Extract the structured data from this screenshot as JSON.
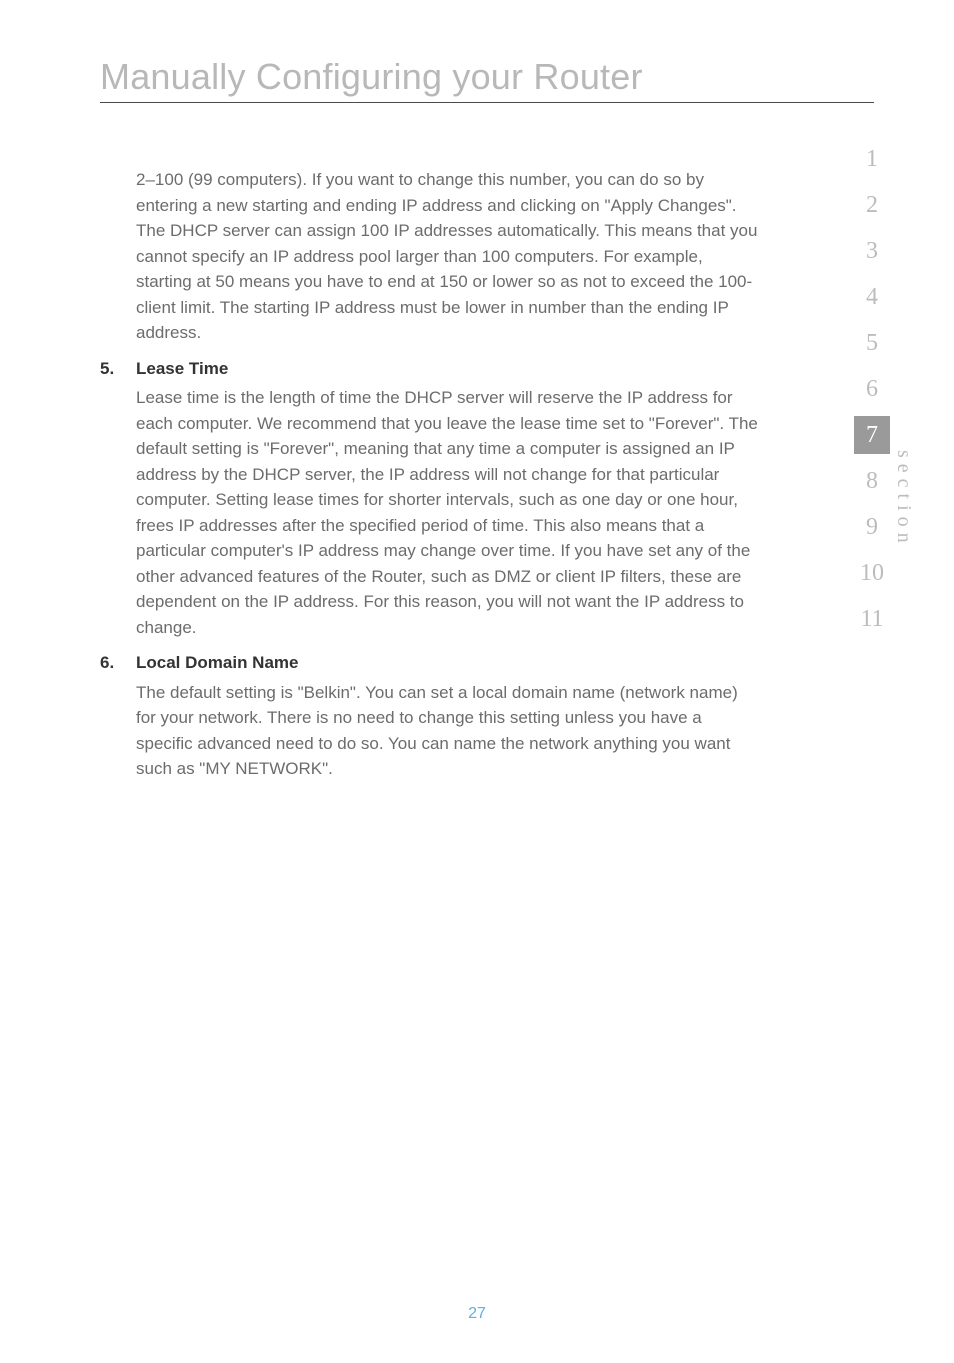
{
  "chapter": {
    "title": "Manually Configuring your Router"
  },
  "content": {
    "intro_cont": "2–100 (99 computers). If you want to change this number, you can do so by entering a new starting and ending IP address and clicking on \"Apply Changes\". The DHCP server can assign 100 IP addresses automatically. This means that you cannot specify an IP address pool larger than 100 computers. For example, starting at 50 means you have to end at 150 or lower so as not to exceed the 100-client limit. The starting IP address must be lower in number than the ending IP address.",
    "items": [
      {
        "num": "5.",
        "heading": "Lease Time",
        "body": "Lease time is the length of time the DHCP server will reserve the IP address for each computer. We recommend that you leave the lease time set to \"Forever\". The default setting is \"Forever\", meaning that any time a computer is assigned an IP address by the DHCP server, the IP address will not change for that particular computer. Setting lease times for shorter intervals, such as one day or one hour, frees IP addresses after the specified period of time. This also means that a particular computer's IP address may change over time. If you have set any of the other advanced features of the Router, such as DMZ or client IP filters, these are dependent on the IP address. For this reason, you will not want the IP address to change."
      },
      {
        "num": "6.",
        "heading": "Local Domain Name",
        "body": "The default setting is \"Belkin\". You can set a local domain name (network name) for your network. There is no need to change this setting unless you have a specific advanced need to do so. You can name the network anything you want such as \"MY NETWORK\"."
      }
    ]
  },
  "sidebar": {
    "label": "section",
    "tabs": [
      "1",
      "2",
      "3",
      "4",
      "5",
      "6",
      "7",
      "8",
      "9",
      "10",
      "11"
    ],
    "active_index": 6
  },
  "page_number": "27"
}
